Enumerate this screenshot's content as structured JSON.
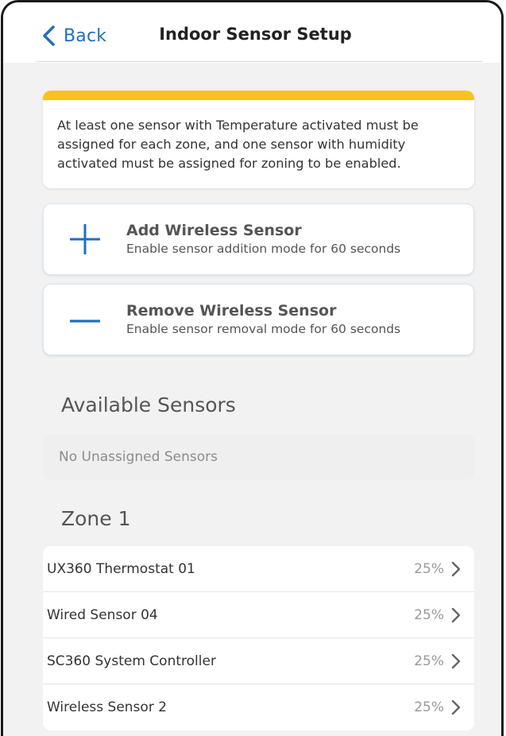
{
  "header": {
    "back_label": "Back",
    "title": "Indoor Sensor Setup"
  },
  "notice": {
    "text": "At least one sensor with Temperature activated must be assigned for each zone, and one sensor with humidity activated must be assigned for zoning to be enabled.",
    "accent_color": "#f9c21b"
  },
  "actions": {
    "add": {
      "title": "Add Wireless Sensor",
      "subtitle": "Enable sensor addition mode for 60 seconds",
      "icon": "plus-icon"
    },
    "remove": {
      "title": "Remove Wireless Sensor",
      "subtitle": "Enable sensor removal mode for 60 seconds",
      "icon": "minus-icon"
    }
  },
  "available": {
    "heading": "Available Sensors",
    "empty_text": "No Unassigned Sensors"
  },
  "zone1": {
    "heading": "Zone 1",
    "sensors": [
      {
        "name": "UX360 Thermostat 01",
        "value": "25%"
      },
      {
        "name": "Wired Sensor 04",
        "value": "25%"
      },
      {
        "name": "SC360 System Controller",
        "value": "25%"
      },
      {
        "name": "Wireless Sensor 2",
        "value": "25%"
      }
    ]
  },
  "colors": {
    "accent_blue": "#1f6fc1",
    "notice_yellow": "#f9c21b",
    "background": "#f2f2f2"
  }
}
